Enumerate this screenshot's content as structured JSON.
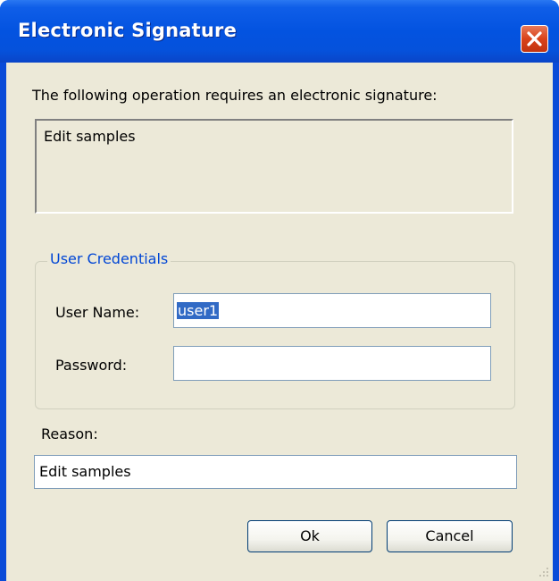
{
  "window": {
    "title": "Electronic Signature",
    "close_icon": "close-icon"
  },
  "operation": {
    "prompt": "The following operation requires an electronic signature:",
    "description": "Edit samples"
  },
  "credentials": {
    "legend": "User Credentials",
    "username_label": "User Name:",
    "username_value": "user1",
    "password_label": "Password:",
    "password_value": ""
  },
  "reason": {
    "label": "Reason:",
    "value": "Edit samples"
  },
  "buttons": {
    "ok_label": "Ok",
    "cancel_label": "Cancel"
  },
  "colors": {
    "titlebar": "#0353e0",
    "close_button": "#d9421a",
    "dialog_bg": "#ece9d8",
    "legend_text": "#0046d5",
    "selection": "#316ac5"
  }
}
